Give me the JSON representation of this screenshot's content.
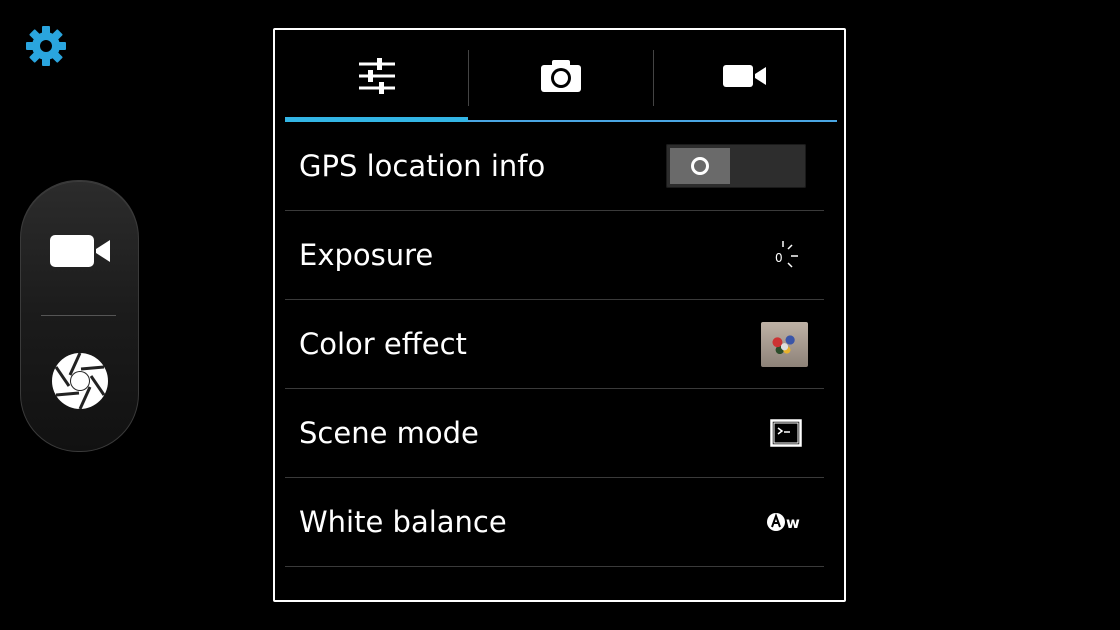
{
  "left_controls": {
    "settings_icon": "gear-icon",
    "video_mode_icon": "video-camera-icon",
    "shutter_icon": "shutter-icon"
  },
  "tabs": [
    {
      "icon": "sliders-icon",
      "active": true
    },
    {
      "icon": "camera-icon",
      "active": false
    },
    {
      "icon": "video-camera-icon",
      "active": false
    }
  ],
  "settings": [
    {
      "label": "GPS location info",
      "control": "toggle",
      "state": "off"
    },
    {
      "label": "Exposure",
      "control": "icon",
      "icon": "exposure-icon",
      "value_text": "0"
    },
    {
      "label": "Color effect",
      "control": "thumbnail",
      "icon": "color-effect-thumbnail"
    },
    {
      "label": "Scene mode",
      "control": "icon",
      "icon": "scene-mode-icon"
    },
    {
      "label": "White balance",
      "control": "icon",
      "icon": "white-balance-auto-icon",
      "value_text": "w"
    }
  ],
  "colors": {
    "accent": "#33b5e5",
    "gear": "#2aa5de",
    "panel_border": "#ffffff",
    "background": "#000000"
  }
}
